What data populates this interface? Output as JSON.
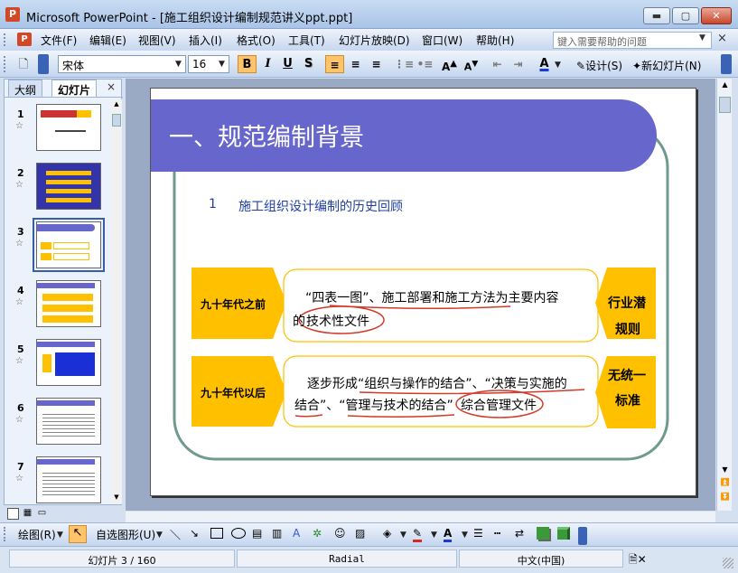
{
  "window": {
    "title": "Microsoft PowerPoint - [施工组织设计编制规范讲义ppt.ppt]",
    "minimize": "▬",
    "maximize": "▢",
    "close": "✕"
  },
  "menu": {
    "items": [
      "文件(F)",
      "编辑(E)",
      "视图(V)",
      "插入(I)",
      "格式(O)",
      "工具(T)",
      "幻灯片放映(D)",
      "窗口(W)",
      "帮助(H)"
    ],
    "help_placeholder": "键入需要帮助的问题",
    "close_label": "×"
  },
  "toolbar": {
    "font": "宋体",
    "size": "16",
    "bold": "B",
    "italic": "I",
    "underline": "U",
    "shadow": "S",
    "design": "设计(S)",
    "new_slide": "新幻灯片(N)"
  },
  "panel": {
    "tab_outline": "大纲",
    "tab_slides": "幻灯片",
    "close": "×",
    "slide_numbers": [
      "1",
      "2",
      "3",
      "4",
      "5",
      "6",
      "7"
    ]
  },
  "slide": {
    "title": "一、规范编制背景",
    "subtitle_num": "1",
    "subtitle": "施工组织设计编制的历史回顾",
    "row1_label": "九十年代之前",
    "row1_text_line1": "“四表一图”、施工部署和施工方法为主要内容",
    "row1_text_line2a": "的",
    "row1_text_line2b": "技术性文件",
    "row1_tag_line1": "行业潜",
    "row1_tag_line2": "规则",
    "row2_label": "九十年代以后",
    "row2_text_line1": "逐步形成“组织与操作的结合”、“决策与实施的",
    "row2_text_line2a": "结合”、“管理与技术的结合”",
    "row2_text_line2b": "综合管理文件",
    "row2_tag_line1": "无统一",
    "row2_tag_line2": "标准",
    "colors": {
      "title_band": "#6666cc",
      "arrow": "#ffc000",
      "frame": "#6f9a8f",
      "red": "#d23a2a",
      "subtitle": "#1f3fa0"
    }
  },
  "drawbar": {
    "draw": "绘图(R)",
    "autoshapes": "自选图形(U)"
  },
  "status": {
    "slide": "幻灯片 3 / 160",
    "theme": "Radial",
    "lang": "中文(中国)"
  }
}
